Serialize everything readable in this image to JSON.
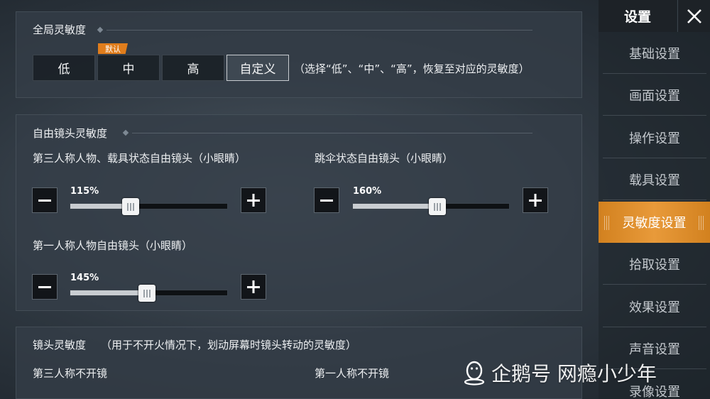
{
  "global_sensitivity": {
    "title": "全局灵敏度",
    "options": [
      "低",
      "中",
      "高",
      "自定义"
    ],
    "default_tag": "默认",
    "selected": "自定义",
    "hint": "（选择“低”、“中”、“高”，恢复至对应的灵敏度）"
  },
  "free_look": {
    "title": "自由镜头灵敏度",
    "sliders": [
      {
        "label": "第三人称人物、载具状态自由镜头（小眼睛）",
        "value_text": "115%",
        "value": 115
      },
      {
        "label": "跳伞状态自由镜头（小眼睛）",
        "value_text": "160%",
        "value": 160
      },
      {
        "label": "第一人称人物自由镜头（小眼睛）",
        "value_text": "145%",
        "value": 145
      }
    ]
  },
  "camera": {
    "title": "镜头灵敏度",
    "note": "（用于不开火情况下，划动屏幕时镜头转动的灵敏度）",
    "col_left": "第三人称不开镜",
    "col_right": "第一人称不开镜"
  },
  "sidebar": {
    "title": "设置",
    "items": [
      "基础设置",
      "画面设置",
      "操作设置",
      "载具设置",
      "灵敏度设置",
      "拾取设置",
      "效果设置",
      "声音设置",
      "录像设置"
    ],
    "active": "灵敏度设置"
  },
  "watermark": "企鹅号 网瘾小少年"
}
